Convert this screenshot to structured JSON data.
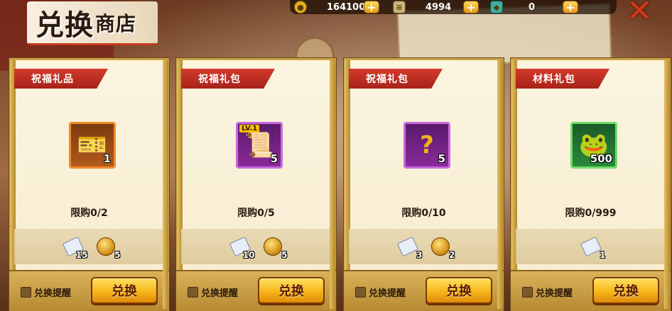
{
  "header": {
    "title_main": "兑换",
    "title_sub": "商店"
  },
  "currencies": [
    {
      "icon": "coin-icon",
      "value": "164100",
      "color": "#e0b020"
    },
    {
      "icon": "ticket-stack-icon",
      "value": "4994",
      "color": "#c8b27a"
    },
    {
      "icon": "gem-icon",
      "value": "0",
      "color": "#3fae9a"
    }
  ],
  "cards": [
    {
      "name": "祝福礼品",
      "item_icon": "ticket-item-icon",
      "item_glyph": "🎫",
      "item_count": "1",
      "rarity_color": "orange",
      "limit": "限购0/2",
      "costs": [
        {
          "type": "ticket",
          "amount": "15"
        },
        {
          "type": "coin",
          "amount": "5"
        }
      ],
      "remind_label": "兑换提醒",
      "button_label": "兑换"
    },
    {
      "name": "祝福礼包",
      "item_icon": "scroll-pack-icon",
      "item_glyph": "📜",
      "item_badge": "LV.1",
      "item_count": "5",
      "rarity_color": "purple",
      "limit": "限购0/5",
      "costs": [
        {
          "type": "ticket",
          "amount": "10"
        },
        {
          "type": "coin",
          "amount": "5"
        }
      ],
      "remind_label": "兑换提醒",
      "button_label": "兑换"
    },
    {
      "name": "祝福礼包",
      "item_icon": "mystery-box-icon",
      "item_glyph": "❓",
      "item_count": "5",
      "rarity_color": "purple",
      "limit": "限购0/10",
      "costs": [
        {
          "type": "ticket",
          "amount": "3"
        },
        {
          "type": "coin",
          "amount": "2"
        }
      ],
      "remind_label": "兑换提醒",
      "button_label": "兑换"
    },
    {
      "name": "材料礼包",
      "item_icon": "green-frog-icon",
      "item_glyph": "🐸",
      "item_count": "500",
      "rarity_color": "green",
      "limit": "限购0/999",
      "costs": [
        {
          "type": "ticket",
          "amount": "1"
        }
      ],
      "remind_label": "兑换提醒",
      "button_label": "兑换"
    }
  ]
}
